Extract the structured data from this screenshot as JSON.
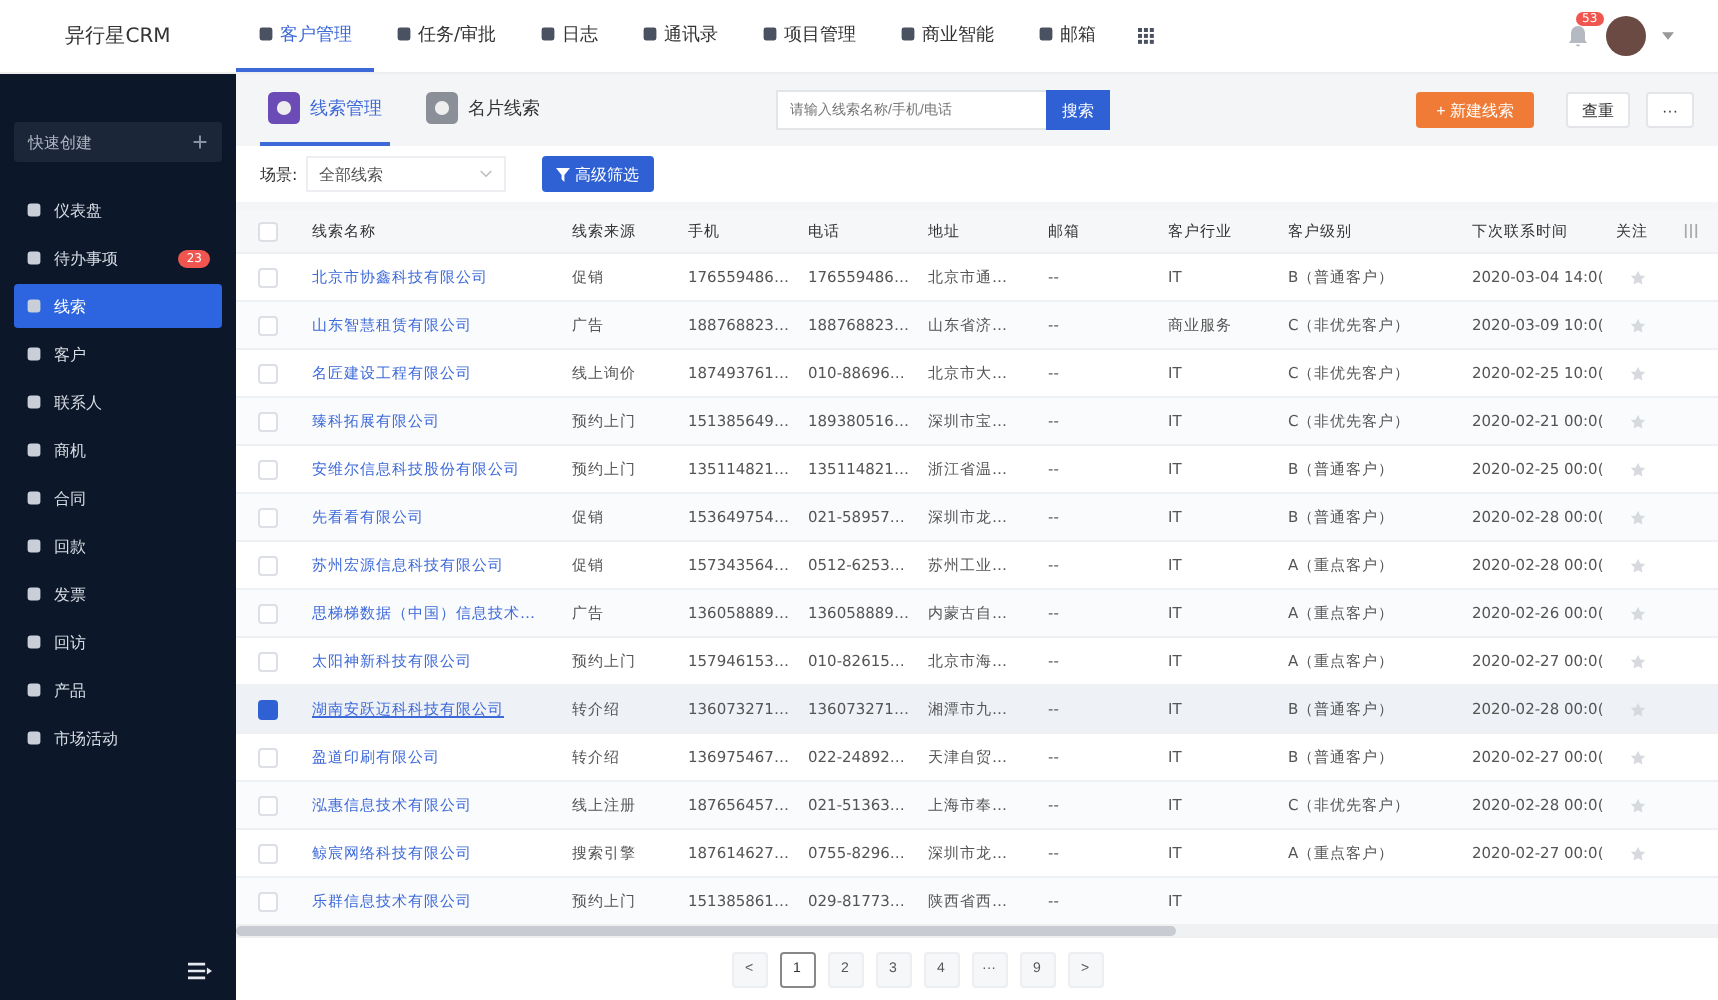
{
  "brand": "异行星CRM",
  "top_nav": [
    {
      "label": "客户管理",
      "selected": true
    },
    {
      "label": "任务/审批",
      "selected": false
    },
    {
      "label": "日志",
      "selected": false
    },
    {
      "label": "通讯录",
      "selected": false
    },
    {
      "label": "项目管理",
      "selected": false
    },
    {
      "label": "商业智能",
      "selected": false
    },
    {
      "label": "邮箱",
      "selected": false
    }
  ],
  "notification_count": "53",
  "sidebar": {
    "quick_create": "快速创建",
    "items": [
      {
        "label": "仪表盘",
        "selected": false
      },
      {
        "label": "待办事项",
        "selected": false,
        "badge": "23"
      },
      {
        "label": "线索",
        "selected": true
      },
      {
        "label": "客户",
        "selected": false
      },
      {
        "label": "联系人",
        "selected": false
      },
      {
        "label": "商机",
        "selected": false
      },
      {
        "label": "合同",
        "selected": false
      },
      {
        "label": "回款",
        "selected": false
      },
      {
        "label": "发票",
        "selected": false
      },
      {
        "label": "回访",
        "selected": false
      },
      {
        "label": "产品",
        "selected": false
      },
      {
        "label": "市场活动",
        "selected": false
      }
    ]
  },
  "sub_tabs": [
    {
      "label": "线索管理",
      "selected": true
    },
    {
      "label": "名片线索",
      "selected": false
    }
  ],
  "search": {
    "placeholder": "请输入线索名称/手机/电话",
    "button": "搜索"
  },
  "actions": {
    "new": "+ 新建线索",
    "dedupe": "查重",
    "more": "···"
  },
  "filter": {
    "label": "场景:",
    "scene": "全部线索",
    "advanced": "高级筛选"
  },
  "table": {
    "all_checked": false,
    "columns": [
      "线索名称",
      "线索来源",
      "手机",
      "电话",
      "地址",
      "邮箱",
      "客户行业",
      "客户级别",
      "下次联系时间",
      "关注"
    ],
    "rows": [
      {
        "selected": false,
        "followed": false,
        "cells": [
          "北京市协鑫科技有限公司",
          "促销",
          "176559486…",
          "176559486…",
          "北京市通…",
          "--",
          "IT",
          "B（普通客户）",
          "2020-03-04 14:0("
        ]
      },
      {
        "selected": false,
        "followed": false,
        "cells": [
          "山东智慧租赁有限公司",
          "广告",
          "188768823…",
          "188768823…",
          "山东省济…",
          "--",
          "商业服务",
          "C（非优先客户）",
          "2020-03-09 10:0("
        ]
      },
      {
        "selected": false,
        "followed": false,
        "cells": [
          "名匠建设工程有限公司",
          "线上询价",
          "187493761…",
          "010-88696…",
          "北京市大…",
          "--",
          "IT",
          "C（非优先客户）",
          "2020-02-25 10:0("
        ]
      },
      {
        "selected": false,
        "followed": false,
        "cells": [
          "臻科拓展有限公司",
          "预约上门",
          "151385649…",
          "189380516…",
          "深圳市宝…",
          "--",
          "IT",
          "C（非优先客户）",
          "2020-02-21 00:0("
        ]
      },
      {
        "selected": false,
        "followed": false,
        "cells": [
          "安维尔信息科技股份有限公司",
          "预约上门",
          "135114821…",
          "135114821…",
          "浙江省温…",
          "--",
          "IT",
          "B（普通客户）",
          "2020-02-25 00:0("
        ]
      },
      {
        "selected": false,
        "followed": false,
        "cells": [
          "先看看有限公司",
          "促销",
          "153649754…",
          "021-58957…",
          "深圳市龙…",
          "--",
          "IT",
          "B（普通客户）",
          "2020-02-28 00:0("
        ]
      },
      {
        "selected": false,
        "followed": false,
        "cells": [
          "苏州宏源信息科技有限公司",
          "促销",
          "157343564…",
          "0512-6253…",
          "苏州工业…",
          "--",
          "IT",
          "A（重点客户）",
          "2020-02-28 00:0("
        ]
      },
      {
        "selected": false,
        "followed": false,
        "cells": [
          "思梯梯数据（中国）信息技术…",
          "广告",
          "136058889…",
          "136058889…",
          "内蒙古自…",
          "--",
          "IT",
          "A（重点客户）",
          "2020-02-26 00:0("
        ]
      },
      {
        "selected": false,
        "followed": false,
        "cells": [
          "太阳神新科技有限公司",
          "预约上门",
          "157946153…",
          "010-82615…",
          "北京市海…",
          "--",
          "IT",
          "A（重点客户）",
          "2020-02-27 00:0("
        ]
      },
      {
        "selected": true,
        "followed": false,
        "cells": [
          "湖南安跃迈科科技有限公司",
          "转介绍",
          "136073271…",
          "136073271…",
          "湘潭市九…",
          "--",
          "IT",
          "B（普通客户）",
          "2020-02-28 00:0("
        ]
      },
      {
        "selected": false,
        "followed": false,
        "cells": [
          "盈道印刷有限公司",
          "转介绍",
          "136975467…",
          "022-24892…",
          "天津自贸…",
          "--",
          "IT",
          "B（普通客户）",
          "2020-02-27 00:0("
        ]
      },
      {
        "selected": false,
        "followed": false,
        "cells": [
          "泓惠信息技术有限公司",
          "线上注册",
          "187656457…",
          "021-51363…",
          "上海市奉…",
          "--",
          "IT",
          "C（非优先客户）",
          "2020-02-28 00:0("
        ]
      },
      {
        "selected": false,
        "followed": false,
        "cells": [
          "鲸宸网络科技有限公司",
          "搜索引擎",
          "187614627…",
          "0755-8296…",
          "深圳市龙…",
          "--",
          "IT",
          "A（重点客户）",
          "2020-02-27 00:0("
        ]
      },
      {
        "selected": false,
        "cells": [
          "乐群信息技术有限公司",
          "预约上门",
          "151385861…",
          "029-81773…",
          "陕西省西…",
          "--",
          "IT"
        ]
      }
    ]
  },
  "pagination": {
    "prev": "<",
    "pages": [
      {
        "label": "1",
        "selected": true
      },
      {
        "label": "2",
        "selected": false
      },
      {
        "label": "3",
        "selected": false
      },
      {
        "label": "4",
        "selected": false
      },
      {
        "label": "···",
        "selected": false
      },
      {
        "label": "9",
        "selected": false
      }
    ],
    "next": ">"
  }
}
